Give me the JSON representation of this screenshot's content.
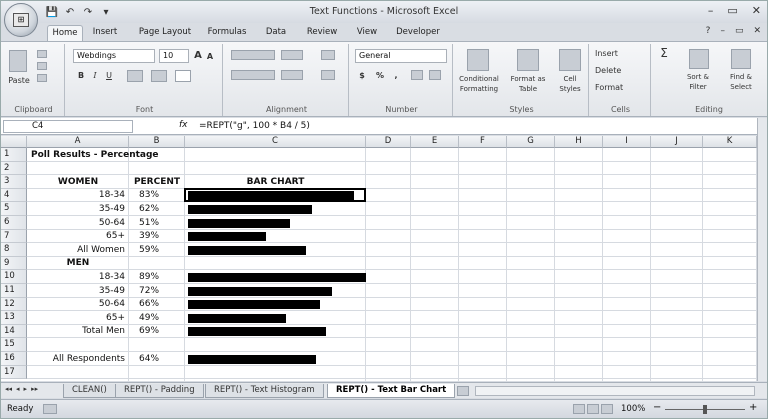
{
  "window": {
    "title": "Text Functions - Microsoft Excel",
    "qat": [
      "💾",
      "↶",
      "↷",
      "▾"
    ],
    "controls": [
      "–",
      "▭",
      "✕"
    ]
  },
  "ribbon_tabs": [
    "Home",
    "Insert",
    "Page Layout",
    "Formulas",
    "Data",
    "Review",
    "View",
    "Developer"
  ],
  "active_tab": "Home",
  "help_controls": [
    "?",
    "–",
    "▭",
    "✕"
  ],
  "ribbon": {
    "clipboard": {
      "paste": "Paste",
      "label": "Clipboard"
    },
    "font": {
      "name": "Webdings",
      "size": "10",
      "label": "Font",
      "bold": "B",
      "italic": "I",
      "underline": "U",
      "grow": "A",
      "shrink": "A"
    },
    "alignment": {
      "label": "Alignment"
    },
    "number": {
      "format": "General",
      "label": "Number",
      "currency": "$",
      "percent": "%",
      "comma": ","
    },
    "styles": {
      "conditional": "Conditional Formatting",
      "format_table": "Format as Table",
      "cell_styles": "Cell Styles",
      "label": "Styles"
    },
    "cells": {
      "insert": "Insert",
      "delete": "Delete",
      "format": "Format",
      "label": "Cells"
    },
    "editing": {
      "sort": "Sort & Filter",
      "find": "Find & Select",
      "label": "Editing",
      "sum": "Σ"
    }
  },
  "formula_bar": {
    "cell_ref": "C4",
    "fx": "fx",
    "formula": "=REPT(\"g\", 100 * B4 / 5)"
  },
  "columns": [
    "A",
    "B",
    "C",
    "D",
    "E",
    "F",
    "G",
    "H",
    "I",
    "J",
    "K"
  ],
  "rows": [
    {
      "n": "1",
      "a": "Poll Results - Percentage",
      "b": "",
      "c": "",
      "bold": true,
      "align": "left"
    },
    {
      "n": "2",
      "a": "",
      "b": "",
      "c": ""
    },
    {
      "n": "3",
      "a": "WOMEN",
      "b": "PERCENT",
      "c": "BAR CHART",
      "bold": true,
      "align": "center"
    },
    {
      "n": "4",
      "a": "18-34",
      "b": "83%",
      "value": 0.83,
      "align": "right"
    },
    {
      "n": "5",
      "a": "35-49",
      "b": "62%",
      "value": 0.62,
      "align": "right"
    },
    {
      "n": "6",
      "a": "50-64",
      "b": "51%",
      "value": 0.51,
      "align": "right"
    },
    {
      "n": "7",
      "a": "65+",
      "b": "39%",
      "value": 0.39,
      "align": "right"
    },
    {
      "n": "8",
      "a": "All Women",
      "b": "59%",
      "value": 0.59,
      "align": "right"
    },
    {
      "n": "9",
      "a": "MEN",
      "b": "",
      "c": "",
      "bold": true,
      "align": "center"
    },
    {
      "n": "10",
      "a": "18-34",
      "b": "89%",
      "value": 0.89,
      "align": "right"
    },
    {
      "n": "11",
      "a": "35-49",
      "b": "72%",
      "value": 0.72,
      "align": "right"
    },
    {
      "n": "12",
      "a": "50-64",
      "b": "66%",
      "value": 0.66,
      "align": "right"
    },
    {
      "n": "13",
      "a": "65+",
      "b": "49%",
      "value": 0.49,
      "align": "right"
    },
    {
      "n": "14",
      "a": "Total Men",
      "b": "69%",
      "value": 0.69,
      "align": "right"
    },
    {
      "n": "15",
      "a": "",
      "b": "",
      "c": ""
    },
    {
      "n": "16",
      "a": "All Respondents",
      "b": "64%",
      "value": 0.64,
      "align": "right"
    },
    {
      "n": "17",
      "a": "",
      "b": "",
      "c": ""
    }
  ],
  "selected_cell": "C4",
  "sheet_nav": [
    "◂◂",
    "◂",
    "▸",
    "▸▸"
  ],
  "sheets": [
    "CLEAN()",
    "REPT() - Padding",
    "REPT() - Text Histogram",
    "REPT() - Text Bar Chart"
  ],
  "active_sheet": "REPT() - Text Bar Chart",
  "status": {
    "mode": "Ready",
    "zoom": "100%",
    "zoom_minus": "−",
    "zoom_plus": "+"
  },
  "colors": {
    "bar": "#000000",
    "accent": "#1f3f6e"
  }
}
